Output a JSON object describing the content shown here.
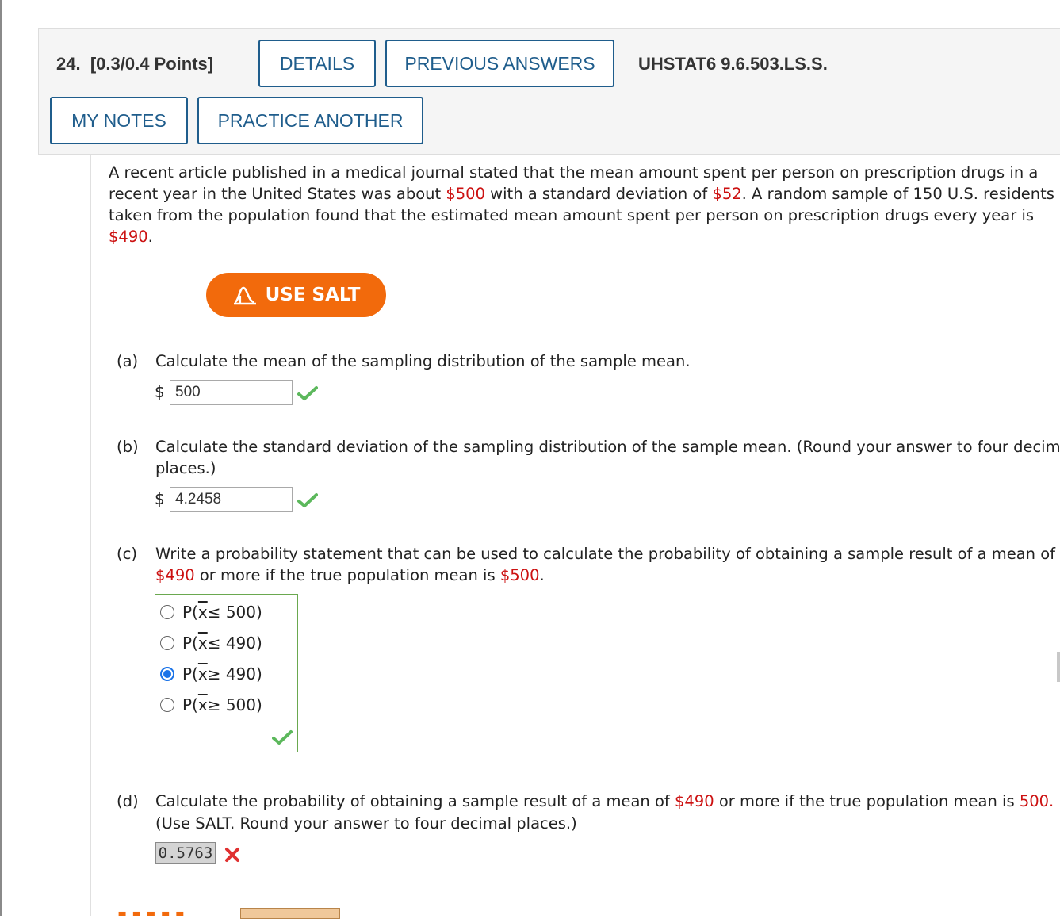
{
  "header": {
    "question_number": "24.",
    "points": "[0.3/0.4 Points]",
    "details_button": "DETAILS",
    "previous_answers_button": "PREVIOUS ANSWERS",
    "problem_code": "UHSTAT6 9.6.503.LS.S.",
    "my_notes_button": "MY NOTES",
    "practice_another_button": "PRACTICE ANOTHER"
  },
  "problem": {
    "line1": "A recent article published in a medical journal stated that the mean amount spent per person on prescription drugs in a",
    "line2_pre": "recent year in the United States was about ",
    "mean_value": "$500",
    "line2_mid": " with a standard deviation of ",
    "sd_value": "$52",
    "line2_post": ". A random sample of 150 U.S. residents",
    "line3": "taken from the population found that the estimated mean amount spent per person on prescription drugs every year is",
    "sample_mean_value": "$490",
    "line4_post": "."
  },
  "salt_button": {
    "label": "USE SALT",
    "icon": "salt-curve-icon"
  },
  "part_a": {
    "label": "(a)",
    "question": "Calculate the mean of the sampling distribution of the sample mean.",
    "currency": "$",
    "answer": "500",
    "status": "correct"
  },
  "part_b": {
    "label": "(b)",
    "question_line1": "Calculate the standard deviation of the sampling distribution of the sample mean. (Round your answer to four decimal",
    "question_line2": "places.)",
    "currency": "$",
    "answer": "4.2458",
    "status": "correct"
  },
  "part_c": {
    "label": "(c)",
    "question_line1": "Write a probability statement that can be used to calculate the probability of obtaining a sample result of a mean of",
    "q2_value1": "$490",
    "q2_mid": " or more if the true population mean is ",
    "q2_value2": "$500",
    "q2_end": ".",
    "options": [
      {
        "prefix": "P(",
        "var": "x",
        "rest": " ≤ 500)",
        "selected": false
      },
      {
        "prefix": "P(",
        "var": "x",
        "rest": " ≤ 490)",
        "selected": false
      },
      {
        "prefix": "P(",
        "var": "x",
        "rest": " ≥ 490)",
        "selected": true
      },
      {
        "prefix": "P(",
        "var": "x",
        "rest": " ≥ 500)",
        "selected": false
      }
    ],
    "status": "correct"
  },
  "part_d": {
    "label": "(d)",
    "q1_pre": "Calculate the probability of obtaining a sample result of a mean of ",
    "q1_value1": "$490",
    "q1_mid": " or more if the true population mean is ",
    "q1_value2": "500.",
    "question_line2": "(Use SALT. Round your answer to four decimal places.)",
    "answer": "0.5763",
    "status": "incorrect"
  },
  "colors": {
    "link_blue": "#1f5d8c",
    "value_red": "#cc1111",
    "salt_orange": "#f26a0c",
    "correct_green": "#5cb85c",
    "incorrect_red": "#e03030",
    "radio_blue": "#1a73e8"
  }
}
